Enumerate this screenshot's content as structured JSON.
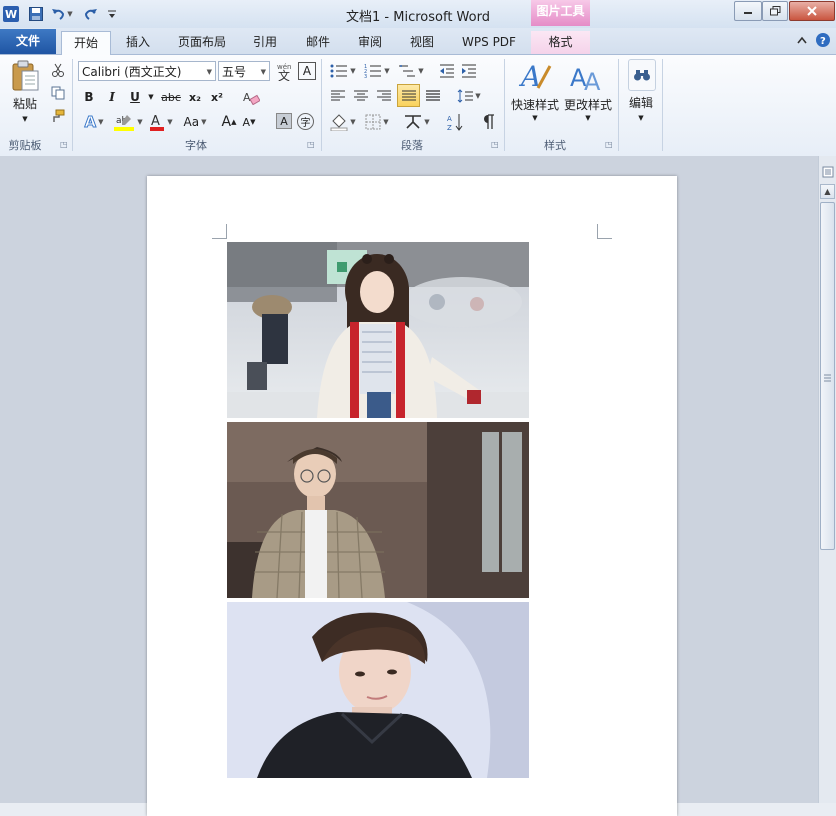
{
  "title": {
    "doc_name": "文档1",
    "separator": "-",
    "app_name": "Microsoft Word",
    "context_tools": "图片工具"
  },
  "tabs": [
    "文件",
    "开始",
    "插入",
    "页面布局",
    "引用",
    "邮件",
    "审阅",
    "视图",
    "WPS PDF",
    "格式"
  ],
  "active_tab": "开始",
  "ribbon": {
    "clipboard": {
      "paste_label": "粘贴",
      "group_label": "剪贴板"
    },
    "font": {
      "font_name": "Calibri (西文正文)",
      "font_size": "五号",
      "bold": "B",
      "italic": "I",
      "underline": "U",
      "strike": "abc",
      "subscript": "x₂",
      "superscript": "x²",
      "grow_font": "A",
      "shrink_font": "A",
      "case": "Aa",
      "clear": "A",
      "phonetic": "wén",
      "enclose": "字",
      "group_label": "字体"
    },
    "paragraph": {
      "group_label": "段落"
    },
    "styles": {
      "quick_styles": "快速样式",
      "change_styles": "更改样式",
      "group_label": "样式"
    },
    "editing": {
      "edit_label": "编辑"
    }
  },
  "icons": [
    "word-icon",
    "save-icon",
    "undo-icon",
    "redo-icon",
    "help-icon",
    "minimize-icon",
    "restore-icon",
    "close-icon",
    "ribbon-collapse-icon",
    "paste-icon",
    "cut-icon",
    "copy-icon",
    "format-painter-icon",
    "find-binoculars-icon"
  ],
  "colors": {
    "file_tab": "#2a62b0",
    "context_tab": "#e58cc7",
    "highlight": "#ffff00",
    "font_color": "#e02020",
    "text_effect": "#3a78c9"
  },
  "document": {
    "images": [
      "photo-girl-red-coat",
      "photo-man-plaid-coat",
      "photo-man-black-jacket"
    ]
  }
}
